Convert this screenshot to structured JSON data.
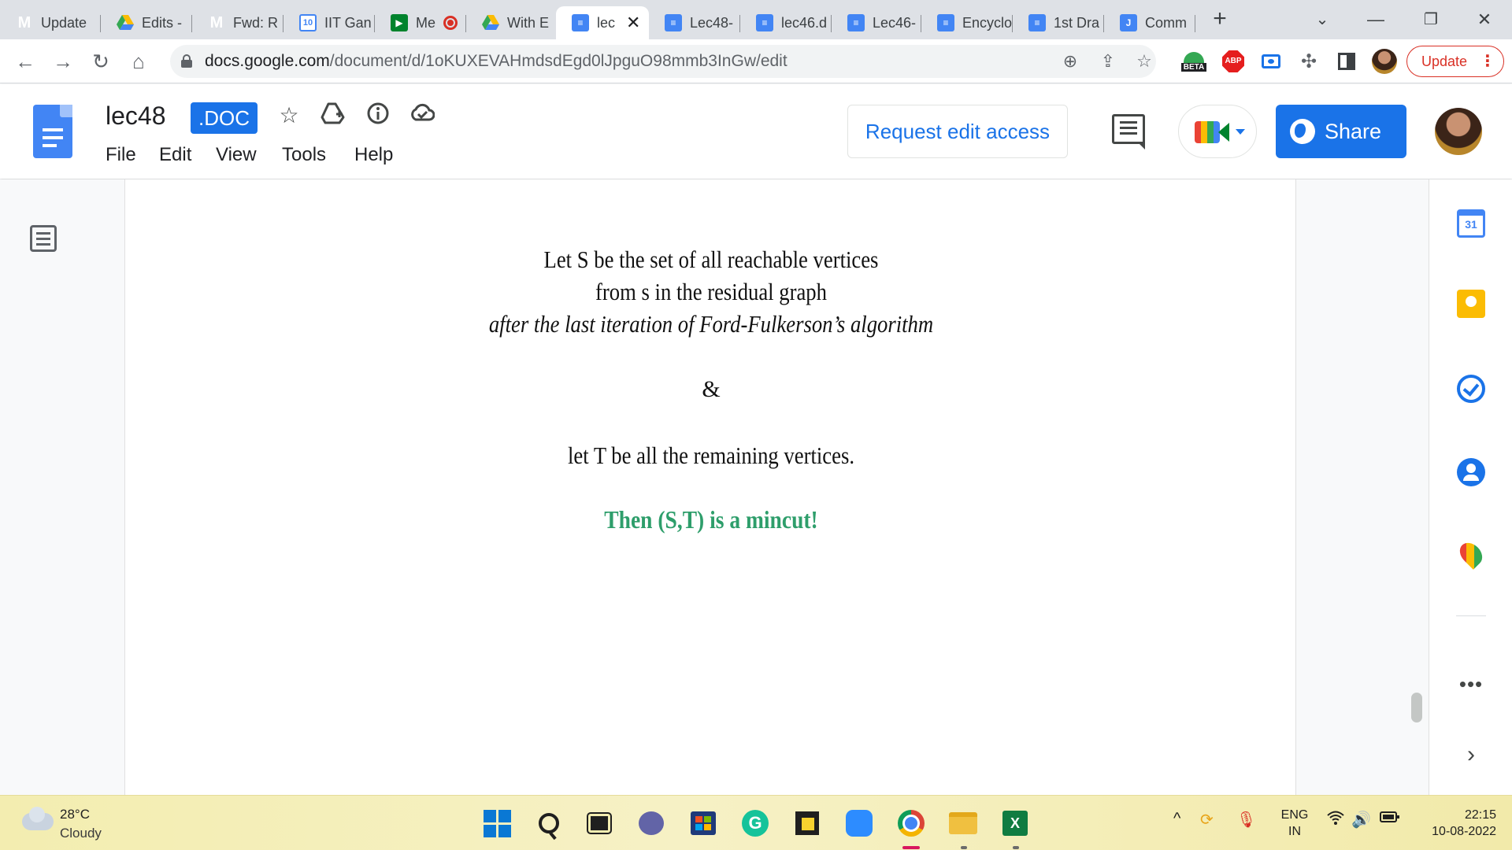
{
  "browser": {
    "tabs": [
      {
        "label": "Update",
        "icon": "gmail-icon"
      },
      {
        "label": "Edits -",
        "icon": "drive-icon"
      },
      {
        "label": "Fwd: R",
        "icon": "gmail-icon"
      },
      {
        "label": "IIT Gan",
        "icon": "calendar-icon",
        "icon_text": "10"
      },
      {
        "label": "Me",
        "icon": "meet-icon",
        "recording": true
      },
      {
        "label": "With E",
        "icon": "drive-icon"
      },
      {
        "label": "lec",
        "icon": "docs-icon",
        "active": true
      },
      {
        "label": "Lec48-",
        "icon": "docs-icon"
      },
      {
        "label": "lec46.d",
        "icon": "docs-icon"
      },
      {
        "label": "Lec46-",
        "icon": "docs-icon"
      },
      {
        "label": "Encyclo",
        "icon": "docs-icon"
      },
      {
        "label": "1st Dra",
        "icon": "docs-icon"
      },
      {
        "label": "Comm",
        "icon": "j-icon",
        "icon_text": "J"
      }
    ],
    "url_host": "docs.google.com",
    "url_path": "/document/d/1oKUXEVAHmdsdEgd0lJpguO98mmb3InGw/edit",
    "extension_beta": "BETA",
    "extension_abp": "ABP",
    "update_label": "Update"
  },
  "docs": {
    "title": "lec48",
    "badge": ".DOC",
    "menu": [
      "File",
      "Edit",
      "View",
      "Tools",
      "Help"
    ],
    "request_access_label": "Request edit access",
    "share_label": "Share",
    "accent": "#1a73e8"
  },
  "content": {
    "line1": "Let S be the set of all reachable vertices",
    "line2": "from s in the residual graph",
    "line3": "after the last iteration of Ford-Fulkerson’s algorithm",
    "ampersand": "&",
    "line4": "let T be all the remaining vertices.",
    "conclusion": "Then (S,T) is a mincut!",
    "conclusion_color": "#2e9e6b"
  },
  "sidepanel": {
    "calendar_day": "31",
    "apps": [
      "calendar-icon",
      "keep-icon",
      "tasks-icon",
      "contacts-icon",
      "maps-icon"
    ]
  },
  "taskbar": {
    "weather_temp": "28°C",
    "weather_desc": "Cloudy",
    "lang_top": "ENG",
    "lang_bottom": "IN",
    "time": "22:15",
    "date": "10-08-2022",
    "excel_letter": "X",
    "grammarly_letter": "G"
  }
}
